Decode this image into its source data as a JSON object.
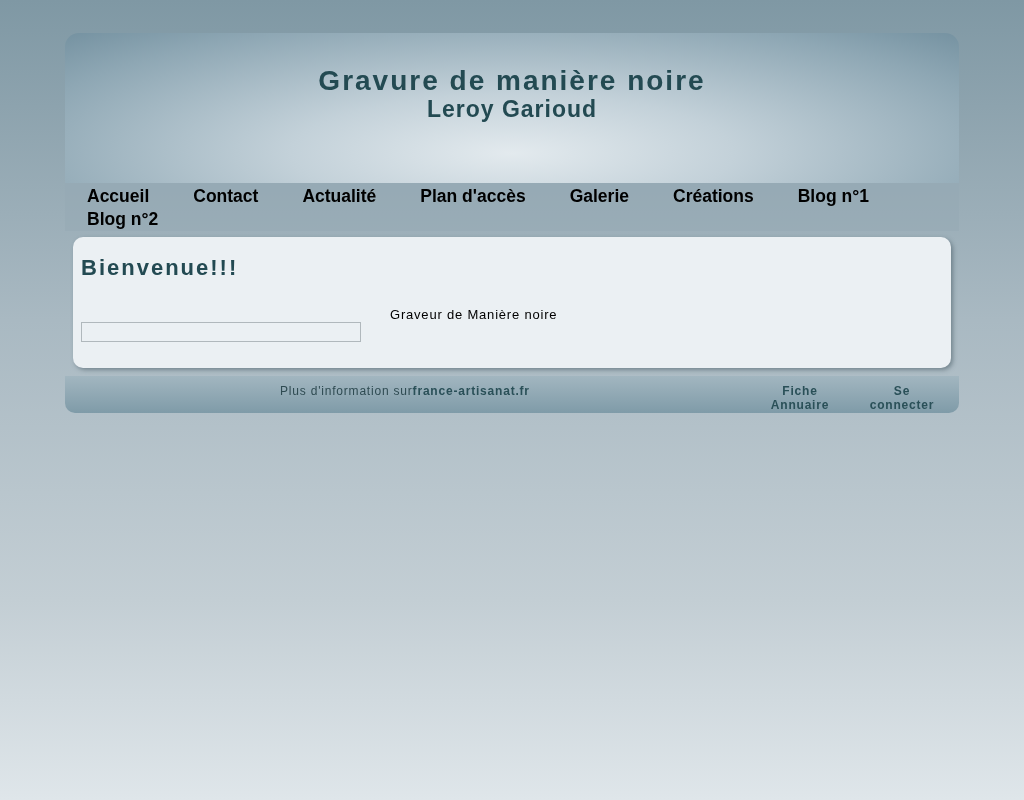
{
  "header": {
    "title": "Gravure de manière noire",
    "subtitle": "Leroy Garioud"
  },
  "nav": [
    {
      "label": "Accueil"
    },
    {
      "label": "Contact"
    },
    {
      "label": "Actualité"
    },
    {
      "label": "Plan d'accès"
    },
    {
      "label": "Galerie"
    },
    {
      "label": "Créations"
    },
    {
      "label": "Blog n°1"
    },
    {
      "label": "Blog n°2"
    }
  ],
  "content": {
    "heading": "Bienvenue!!!",
    "caption": "Graveur de Manière noire"
  },
  "footer": {
    "text": "Plus d'information sur",
    "link": "france-artisanat.fr",
    "links": [
      "Fiche Annuaire",
      "Se connecter"
    ]
  }
}
